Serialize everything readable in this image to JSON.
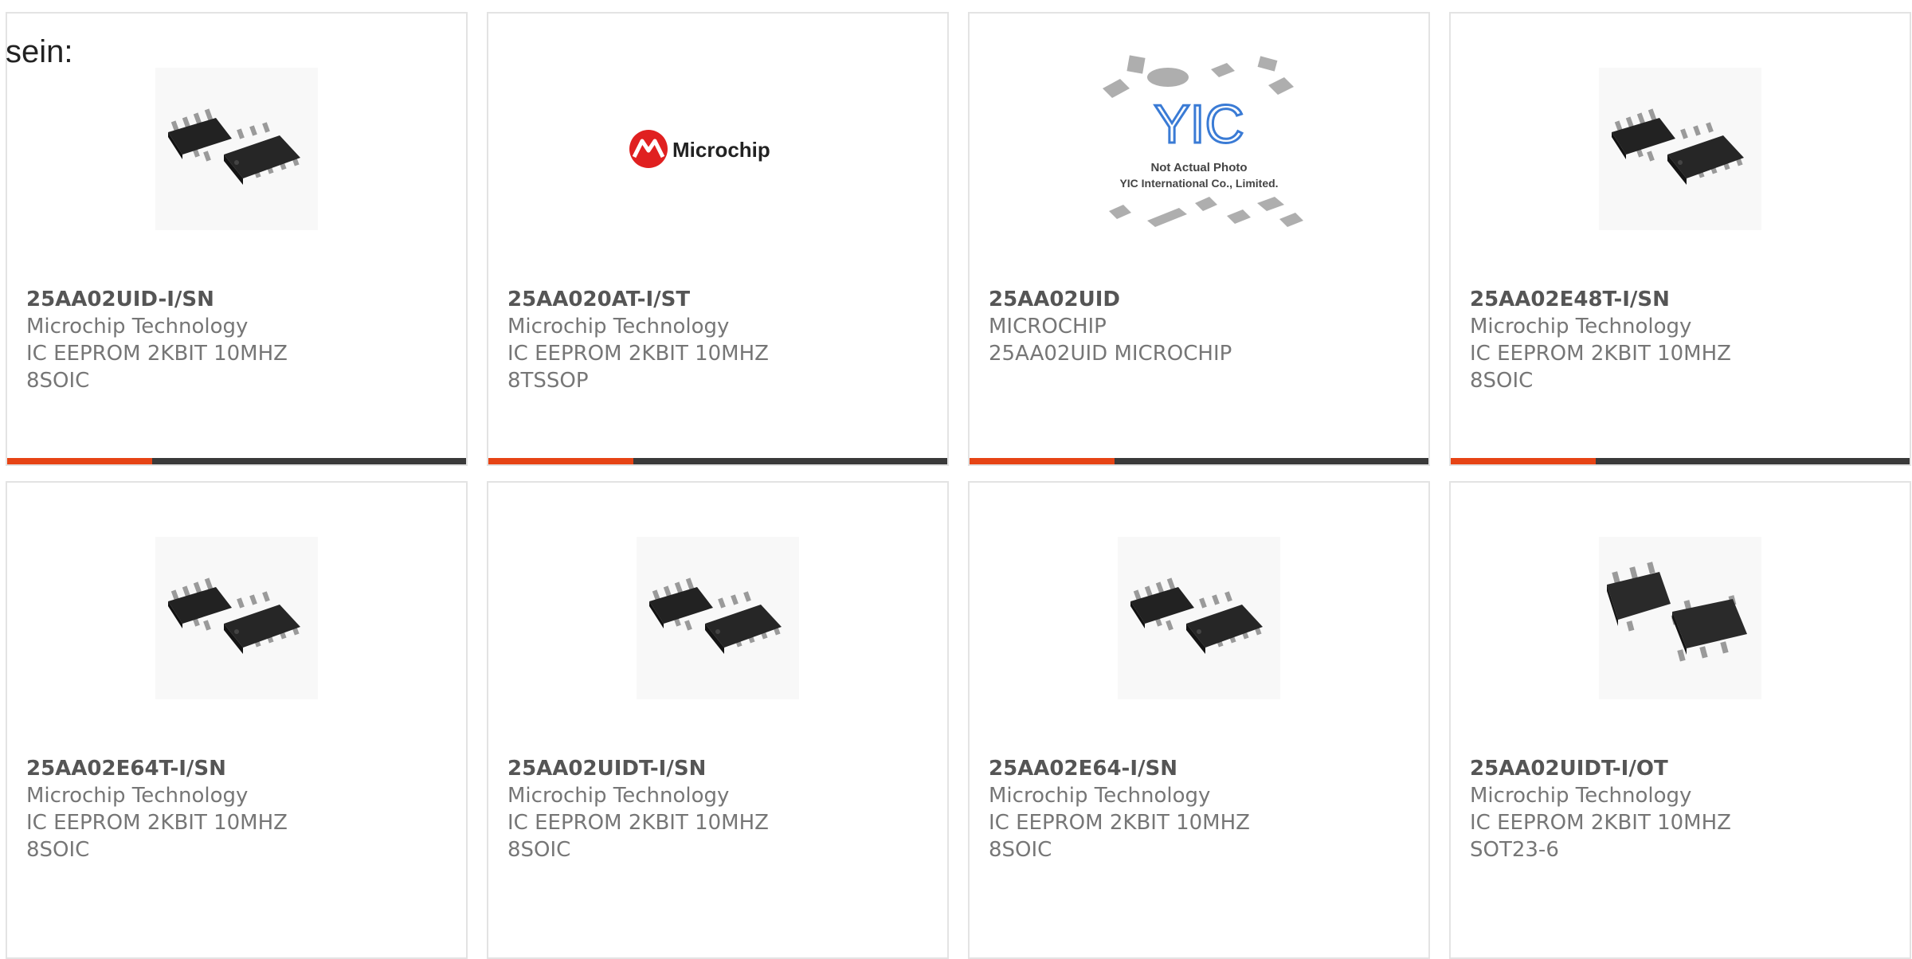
{
  "intro_text": "sein:",
  "colors": {
    "accent": "#e64415",
    "bar": "#3a3a3a",
    "part_number": "#555555",
    "secondary_text": "#767676",
    "card_border": "#e3e3e3"
  },
  "products": [
    {
      "part_number": "25AA02UID-I/SN",
      "manufacturer": "Microchip Technology",
      "description": "IC EEPROM 2KBIT 10MHZ 8SOIC",
      "image": "soic-8-chip-icon"
    },
    {
      "part_number": "25AA020AT-I/ST",
      "manufacturer": "Microchip Technology",
      "description": "IC EEPROM 2KBIT 10MHZ 8TSSOP",
      "image": "microchip-logo",
      "logo_text": "Microchip"
    },
    {
      "part_number": "25AA02UID",
      "manufacturer": "MICROCHIP",
      "description": "25AA02UID MICROCHIP",
      "image": "yic-placeholder",
      "logo_text": "YIC",
      "caption_line1": "Not Actual Photo",
      "caption_line2": "YIC International Co., Limited."
    },
    {
      "part_number": "25AA02E48T-I/SN",
      "manufacturer": "Microchip Technology",
      "description": "IC EEPROM 2KBIT 10MHZ 8SOIC",
      "image": "soic-8-chip-icon"
    },
    {
      "part_number": "25AA02E64T-I/SN",
      "manufacturer": "Microchip Technology",
      "description": "IC EEPROM 2KBIT 10MHZ 8SOIC",
      "image": "soic-8-chip-icon"
    },
    {
      "part_number": "25AA02UIDT-I/SN",
      "manufacturer": "Microchip Technology",
      "description": "IC EEPROM 2KBIT 10MHZ 8SOIC",
      "image": "soic-8-chip-icon"
    },
    {
      "part_number": "25AA02E64-I/SN",
      "manufacturer": "Microchip Technology",
      "description": "IC EEPROM 2KBIT 10MHZ 8SOIC",
      "image": "soic-8-chip-icon"
    },
    {
      "part_number": "25AA02UIDT-I/OT",
      "manufacturer": "Microchip Technology",
      "description": "IC EEPROM 2KBIT 10MHZ SOT23-6",
      "image": "sot23-6-chip-icon"
    }
  ]
}
